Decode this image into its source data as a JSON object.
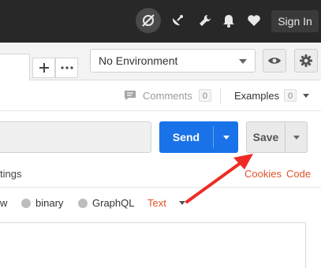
{
  "topbar": {
    "sign_in_label": "Sign In"
  },
  "tabs": {
    "add_label": "+",
    "more_label": "•••"
  },
  "environment": {
    "selected": "No Environment"
  },
  "subheader": {
    "comments_label": "Comments",
    "comments_count": "0",
    "examples_label": "Examples",
    "examples_count": "0"
  },
  "request": {
    "send_label": "Send",
    "save_label": "Save"
  },
  "settings_row": {
    "partial_text": "tings",
    "cookies_label": "Cookies",
    "code_label": "Code"
  },
  "body_types": {
    "partial_text": "w",
    "options": [
      "binary",
      "GraphQL"
    ],
    "selected_type": "Text"
  },
  "colors": {
    "accent": "#1a72e8",
    "link": "#e0532b",
    "topbar_bg": "#282828",
    "annotation_arrow": "#ee2b24"
  },
  "icons": [
    "no-sync-icon",
    "satellite-icon",
    "wrench-icon",
    "bell-icon",
    "heart-icon",
    "eye-icon",
    "gear-icon",
    "comment-icon",
    "plus-icon",
    "ellipsis-icon"
  ]
}
